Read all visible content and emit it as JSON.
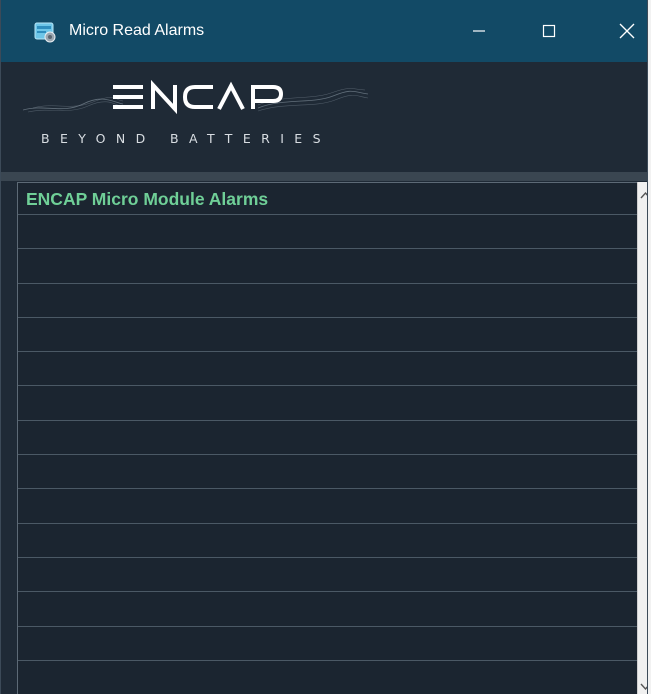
{
  "window": {
    "title": "Micro Read Alarms",
    "icon": "app-window-icon"
  },
  "logo": {
    "brand": "ENCAP",
    "tagline": "BEYOND BATTERIES"
  },
  "grid": {
    "header": "ENCAP Micro Module Alarms",
    "rows": [
      "",
      "",
      "",
      "",
      "",
      "",
      "",
      "",
      "",
      "",
      "",
      "",
      "",
      ""
    ]
  },
  "colors": {
    "titlebar": "#124a66",
    "background": "#1f2a36",
    "header_text": "#6fcf97"
  }
}
